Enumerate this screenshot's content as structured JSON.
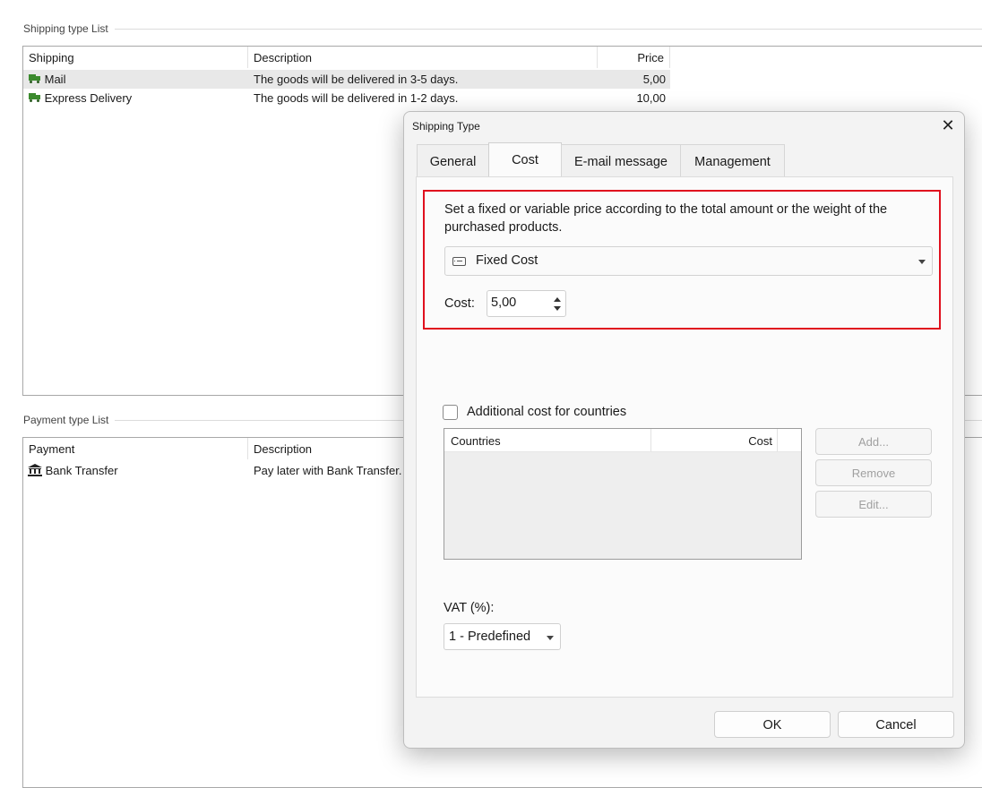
{
  "shipping_group": {
    "label": "Shipping type List",
    "columns": {
      "name": "Shipping",
      "description": "Description",
      "price": "Price"
    },
    "rows": [
      {
        "name": "Mail",
        "description": "The goods will be delivered in 3-5 days.",
        "price": "5,00",
        "icon": "truck-icon"
      },
      {
        "name": "Express Delivery",
        "description": "The goods will be delivered in 1-2 days.",
        "price": "10,00",
        "icon": "truck-icon"
      }
    ]
  },
  "payment_group": {
    "label": "Payment type List",
    "columns": {
      "name": "Payment",
      "description": "Description"
    },
    "rows": [
      {
        "name": "Bank Transfer",
        "description": "Pay later with Bank Transfer.",
        "icon": "bank-icon"
      }
    ]
  },
  "dialog": {
    "title": "Shipping Type",
    "tabs": [
      {
        "label": "General",
        "active": false
      },
      {
        "label": "Cost",
        "active": true
      },
      {
        "label": "E-mail message",
        "active": false
      },
      {
        "label": "Management",
        "active": false
      }
    ],
    "cost_tab": {
      "description": "Set a fixed or variable price according to the total amount or the weight of the purchased products.",
      "cost_type": "Fixed Cost",
      "cost_label": "Cost:",
      "cost_value": "5,00",
      "additional_cost_label": "Additional cost for countries",
      "additional_cost_checked": false,
      "countries_table": {
        "col_countries": "Countries",
        "col_cost": "Cost"
      },
      "add_button": "Add...",
      "remove_button": "Remove",
      "edit_button": "Edit...",
      "vat_label": "VAT (%):",
      "vat_value": "1 - Predefined"
    },
    "ok_button": "OK",
    "cancel_button": "Cancel"
  },
  "colors": {
    "highlight_border": "#e0101e",
    "icon_green": "#3c8a2e"
  }
}
